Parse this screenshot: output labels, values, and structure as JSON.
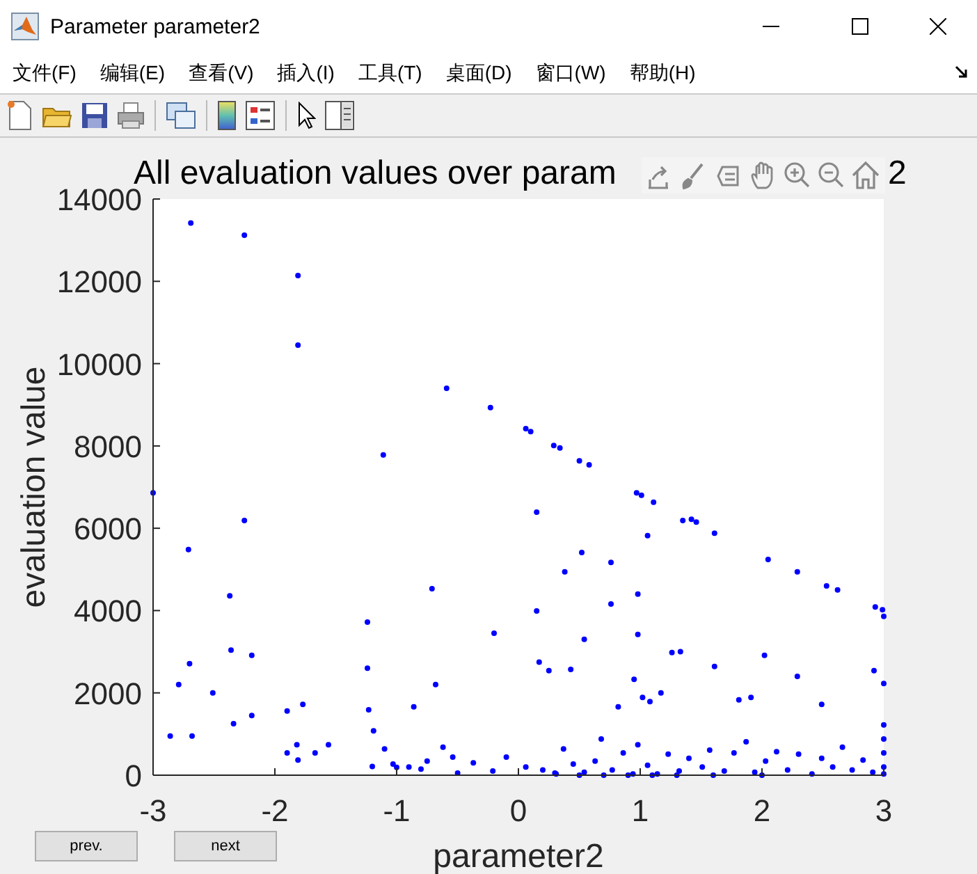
{
  "window": {
    "title": "Parameter parameter2"
  },
  "menu": [
    "文件(F)",
    "编辑(E)",
    "查看(V)",
    "插入(I)",
    "工具(T)",
    "桌面(D)",
    "窗口(W)",
    "帮助(H)"
  ],
  "axes": {
    "title_start": "All evaluation values over param",
    "title_end": "2",
    "chart_data": {
      "type": "scatter",
      "xlabel": "parameter2",
      "ylabel": "evaluation value",
      "xlim": [
        -3,
        3
      ],
      "ylim": [
        0,
        14000
      ],
      "xticks": [
        -3,
        -2,
        -1,
        0,
        1,
        2,
        3
      ],
      "yticks": [
        0,
        2000,
        4000,
        6000,
        8000,
        10000,
        12000,
        14000
      ],
      "x": [
        -2.69,
        -2.25,
        -1.81,
        -1.81,
        -0.59,
        -0.23,
        0.06,
        0.1,
        0.29,
        0.34,
        0.5,
        0.58,
        -1.11,
        -3,
        0.97,
        1.01,
        1.11,
        1.35,
        1.42,
        1.46,
        0.15,
        -2.25,
        1.61,
        1.06,
        -2.71,
        0.52,
        2.05,
        2.29,
        2.53,
        2.62,
        -0.71,
        -2.37,
        0.38,
        0.76,
        0.76,
        0.98,
        2.93,
        2.99,
        3,
        -1.24,
        0.15,
        -0.2,
        0.98,
        0.54,
        -2.36,
        -2.19,
        1.26,
        1.33,
        -2.7,
        -1.24,
        0.17,
        0.25,
        0.43,
        1.61,
        2.02,
        2.29,
        2.92,
        0.95,
        3,
        -0.68,
        -2.79,
        -2.51,
        -0.86,
        0.82,
        -1.77,
        1.02,
        1.08,
        1.91,
        1.81,
        1.17,
        2.49,
        -1.9,
        -2.34,
        -2.19,
        -2.86,
        -2.68,
        -1.9,
        -1.82,
        -1.81,
        -1.67,
        -1.56,
        -1.23,
        -1.19,
        -1.1,
        -1.03,
        -0.9,
        -0.75,
        -0.62,
        -0.54,
        -0.37,
        -0.21,
        -0.1,
        0.06,
        0.2,
        0.31,
        0.37,
        0.45,
        0.54,
        0.63,
        0.68,
        0.77,
        0.86,
        0.94,
        0.98,
        1.06,
        1.14,
        1.23,
        1.32,
        1.4,
        1.51,
        1.57,
        1.69,
        1.77,
        1.87,
        1.94,
        2.03,
        2.12,
        2.21,
        2.3,
        2.41,
        2.49,
        2.58,
        2.66,
        2.74,
        2.83,
        2.91,
        3,
        3,
        3,
        3,
        3,
        0.5,
        0.7,
        0.9,
        1.1,
        1.3,
        0.3,
        1.6,
        2.0,
        -0.5,
        -0.8,
        -1.2,
        -1.0
      ],
      "series": [
        {
          "color": "#0000ff",
          "values": [
            13420,
            13120,
            12140,
            10450,
            9400,
            8930,
            8420,
            8350,
            8010,
            7950,
            7640,
            7540,
            7780,
            6860,
            6860,
            6800,
            6630,
            6190,
            6220,
            6150,
            6390,
            6190,
            5880,
            5820,
            5480,
            5410,
            5240,
            4940,
            4600,
            4500,
            4530,
            4360,
            4940,
            5170,
            4160,
            4400,
            4090,
            4020,
            3860,
            3720,
            3990,
            3450,
            3420,
            3300,
            3040,
            2910,
            2980,
            3000,
            2710,
            2600,
            2750,
            2540,
            2570,
            2640,
            2910,
            2400,
            2540,
            2330,
            2230,
            2200,
            2200,
            2000,
            1660,
            1660,
            1720,
            1890,
            1790,
            1890,
            1830,
            2000,
            1720,
            1560,
            1250,
            1450,
            950,
            950,
            540,
            740,
            370,
            540,
            740,
            1590,
            1080,
            640,
            270,
            200,
            340,
            680,
            440,
            300,
            100,
            440,
            200,
            130,
            30,
            640,
            270,
            70,
            340,
            880,
            130,
            540,
            30,
            740,
            240,
            30,
            510,
            100,
            410,
            200,
            610,
            100,
            540,
            810,
            70,
            340,
            570,
            130,
            510,
            30,
            410,
            200,
            680,
            130,
            370,
            70,
            1220,
            880,
            540,
            200,
            30,
            0,
            0,
            0,
            0,
            0,
            50,
            0,
            0,
            50,
            150,
            210,
            190
          ]
        }
      ]
    }
  },
  "buttons": [
    {
      "label": "prev."
    },
    {
      "label": "next"
    }
  ]
}
